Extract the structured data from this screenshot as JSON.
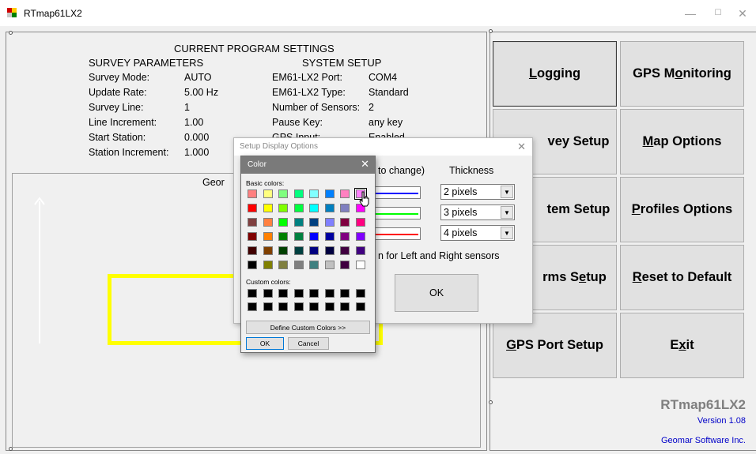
{
  "window": {
    "title": "RTmap61LX2",
    "minimize_glyph": "—",
    "maximize_glyph": "☐",
    "close_glyph": "✕"
  },
  "settings": {
    "heading": "CURRENT PROGRAM SETTINGS",
    "survey_heading": "SURVEY PARAMETERS",
    "system_heading": "SYSTEM SETUP",
    "survey_rows": [
      {
        "label": "Survey Mode:",
        "value": "AUTO"
      },
      {
        "label": "Update Rate:",
        "value": "5.00 Hz"
      },
      {
        "label": "Survey Line:",
        "value": "1"
      },
      {
        "label": "Line Increment:",
        "value": "1.00"
      },
      {
        "label": "Start Station:",
        "value": "0.000"
      },
      {
        "label": "Station Increment:",
        "value": "1.000"
      }
    ],
    "system_rows": [
      {
        "label": "EM61-LX2 Port:",
        "value": "COM4"
      },
      {
        "label": "EM61-LX2 Type:",
        "value": "Standard"
      },
      {
        "label": "Number of Sensors:",
        "value": "2"
      },
      {
        "label": "Pause Key:",
        "value": "any key"
      },
      {
        "label": "GPS Input:",
        "value": "Enabled"
      }
    ]
  },
  "map": {
    "label": "Geor"
  },
  "buttons": {
    "logging": {
      "prefix": "",
      "accel": "L",
      "suffix": "ogging"
    },
    "gps_monitoring": {
      "prefix": "GPS M",
      "accel": "o",
      "suffix": "nitoring"
    },
    "survey_setup": {
      "prefix": "",
      "accel": "",
      "suffix": "vey Setup"
    },
    "map_options": {
      "prefix": "",
      "accel": "M",
      "suffix": "ap Options"
    },
    "system_setup": {
      "prefix": "",
      "accel": "",
      "suffix": "tem Setup"
    },
    "profiles_options": {
      "prefix": "",
      "accel": "P",
      "suffix": "rofiles Options"
    },
    "alarms_setup": {
      "prefix": "rms S",
      "accel": "e",
      "suffix": "tup"
    },
    "reset_default": {
      "prefix": "",
      "accel": "R",
      "suffix": "eset to Default"
    },
    "gps_port": {
      "prefix": "",
      "accel": "G",
      "suffix": "PS Port Setup"
    },
    "exit": {
      "prefix": "E",
      "accel": "x",
      "suffix": "it"
    }
  },
  "branding": {
    "logo": "RTmap61LX2",
    "version": "Version 1.08",
    "company": "Geomar Software Inc."
  },
  "display_dialog": {
    "title": "Setup Display Options",
    "color_header": "to change)",
    "thickness_header": "Thickness",
    "rows": [
      {
        "line_color": "#0000ff",
        "thickness": "2 pixels"
      },
      {
        "line_color": "#00ff00",
        "thickness": "3 pixels"
      },
      {
        "line_color": "#ff0000",
        "thickness": "4 pixels"
      }
    ],
    "note": "n for Left and Right sensors",
    "ok_label": "OK"
  },
  "color_dialog": {
    "title": "Color",
    "basic_label": "Basic colors:",
    "custom_label": "Custom colors:",
    "define_label": "Define Custom Colors >>",
    "ok_label": "OK",
    "cancel_label": "Cancel",
    "selected_index": 7,
    "basic_colors": [
      "#ff8080",
      "#ffff80",
      "#80ff80",
      "#00ff80",
      "#80ffff",
      "#0080ff",
      "#ff80c0",
      "#ff80ff",
      "#ff0000",
      "#ffff00",
      "#80ff00",
      "#00ff40",
      "#00ffff",
      "#0080c0",
      "#8080c0",
      "#ff00ff",
      "#804040",
      "#ff8040",
      "#00ff00",
      "#008080",
      "#004080",
      "#8080ff",
      "#800040",
      "#ff0080",
      "#800000",
      "#ff8000",
      "#008000",
      "#008040",
      "#0000ff",
      "#0000a0",
      "#800080",
      "#8000ff",
      "#400000",
      "#804000",
      "#004000",
      "#004040",
      "#000080",
      "#000040",
      "#400040",
      "#400080",
      "#000000",
      "#808000",
      "#808040",
      "#808080",
      "#408080",
      "#c0c0c0",
      "#400040",
      "#ffffff"
    ],
    "custom_colors": [
      "#000000",
      "#000000",
      "#000000",
      "#000000",
      "#000000",
      "#000000",
      "#000000",
      "#000000",
      "#000000",
      "#000000",
      "#000000",
      "#000000",
      "#000000",
      "#000000",
      "#000000",
      "#000000"
    ]
  }
}
